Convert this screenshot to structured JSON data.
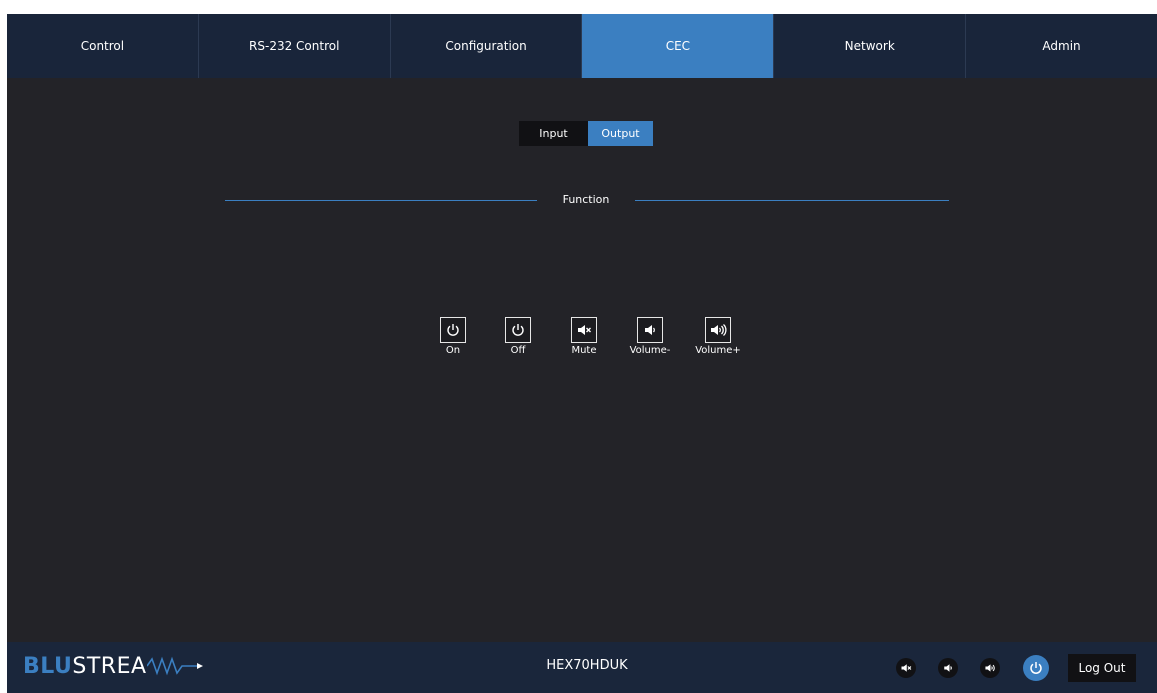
{
  "nav": {
    "tabs": [
      {
        "label": "Control"
      },
      {
        "label": "RS-232 Control"
      },
      {
        "label": "Configuration"
      },
      {
        "label": "CEC",
        "active": true
      },
      {
        "label": "Network"
      },
      {
        "label": "Admin"
      }
    ]
  },
  "toggle": {
    "input_label": "Input",
    "output_label": "Output",
    "selected": "Output"
  },
  "section": {
    "title": "Function"
  },
  "functions": [
    {
      "label": "On",
      "icon": "power-icon"
    },
    {
      "label": "Off",
      "icon": "power-icon"
    },
    {
      "label": "Mute",
      "icon": "speaker-mute-icon"
    },
    {
      "label": "Volume-",
      "icon": "volume-down-icon"
    },
    {
      "label": "Volume+",
      "icon": "volume-up-icon"
    }
  ],
  "footer": {
    "brand_blu": "BLU",
    "brand_stream": "STREA",
    "model": "HEX70HDUK",
    "logout_label": "Log Out",
    "icons": [
      "speaker-mute-icon",
      "volume-down-icon",
      "volume-up-icon",
      "power-icon"
    ]
  },
  "colors": {
    "accent": "#3b7fc1",
    "background": "#232328",
    "nav_background": "#19253a"
  }
}
